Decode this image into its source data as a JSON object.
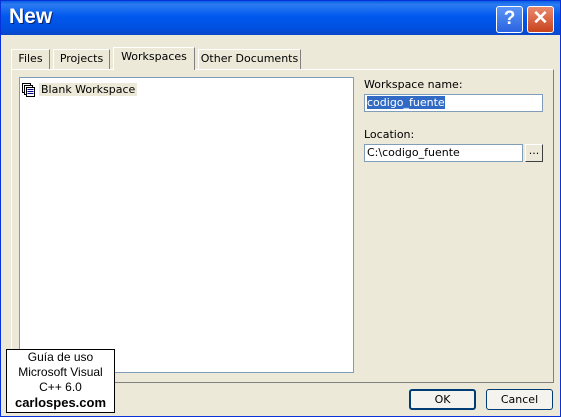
{
  "window": {
    "title": "New",
    "help_glyph": "?",
    "close_glyph": "✕"
  },
  "tabs": [
    {
      "label": "Files"
    },
    {
      "label": "Projects"
    },
    {
      "label": "Workspaces",
      "active": true
    },
    {
      "label": "Other Documents"
    }
  ],
  "workspace_list": {
    "items": [
      {
        "label": "Blank Workspace",
        "icon": "workspace-icon",
        "selected": true
      }
    ]
  },
  "form": {
    "name_label": "Workspace name:",
    "name_value": "codigo_fuente",
    "location_label": "Location:",
    "location_value": "C:\\codigo_fuente",
    "browse_label": "..."
  },
  "buttons": {
    "ok": "OK",
    "cancel": "Cancel"
  },
  "watermark": {
    "line1": "Guía de uso",
    "line2": "Microsoft Visual",
    "line3": "C++ 6.0",
    "line4": "carlospes.com"
  },
  "colors": {
    "titlebar": "#0058EE",
    "dialog_bg": "#ECE9D8",
    "selection": "#316AC5"
  }
}
